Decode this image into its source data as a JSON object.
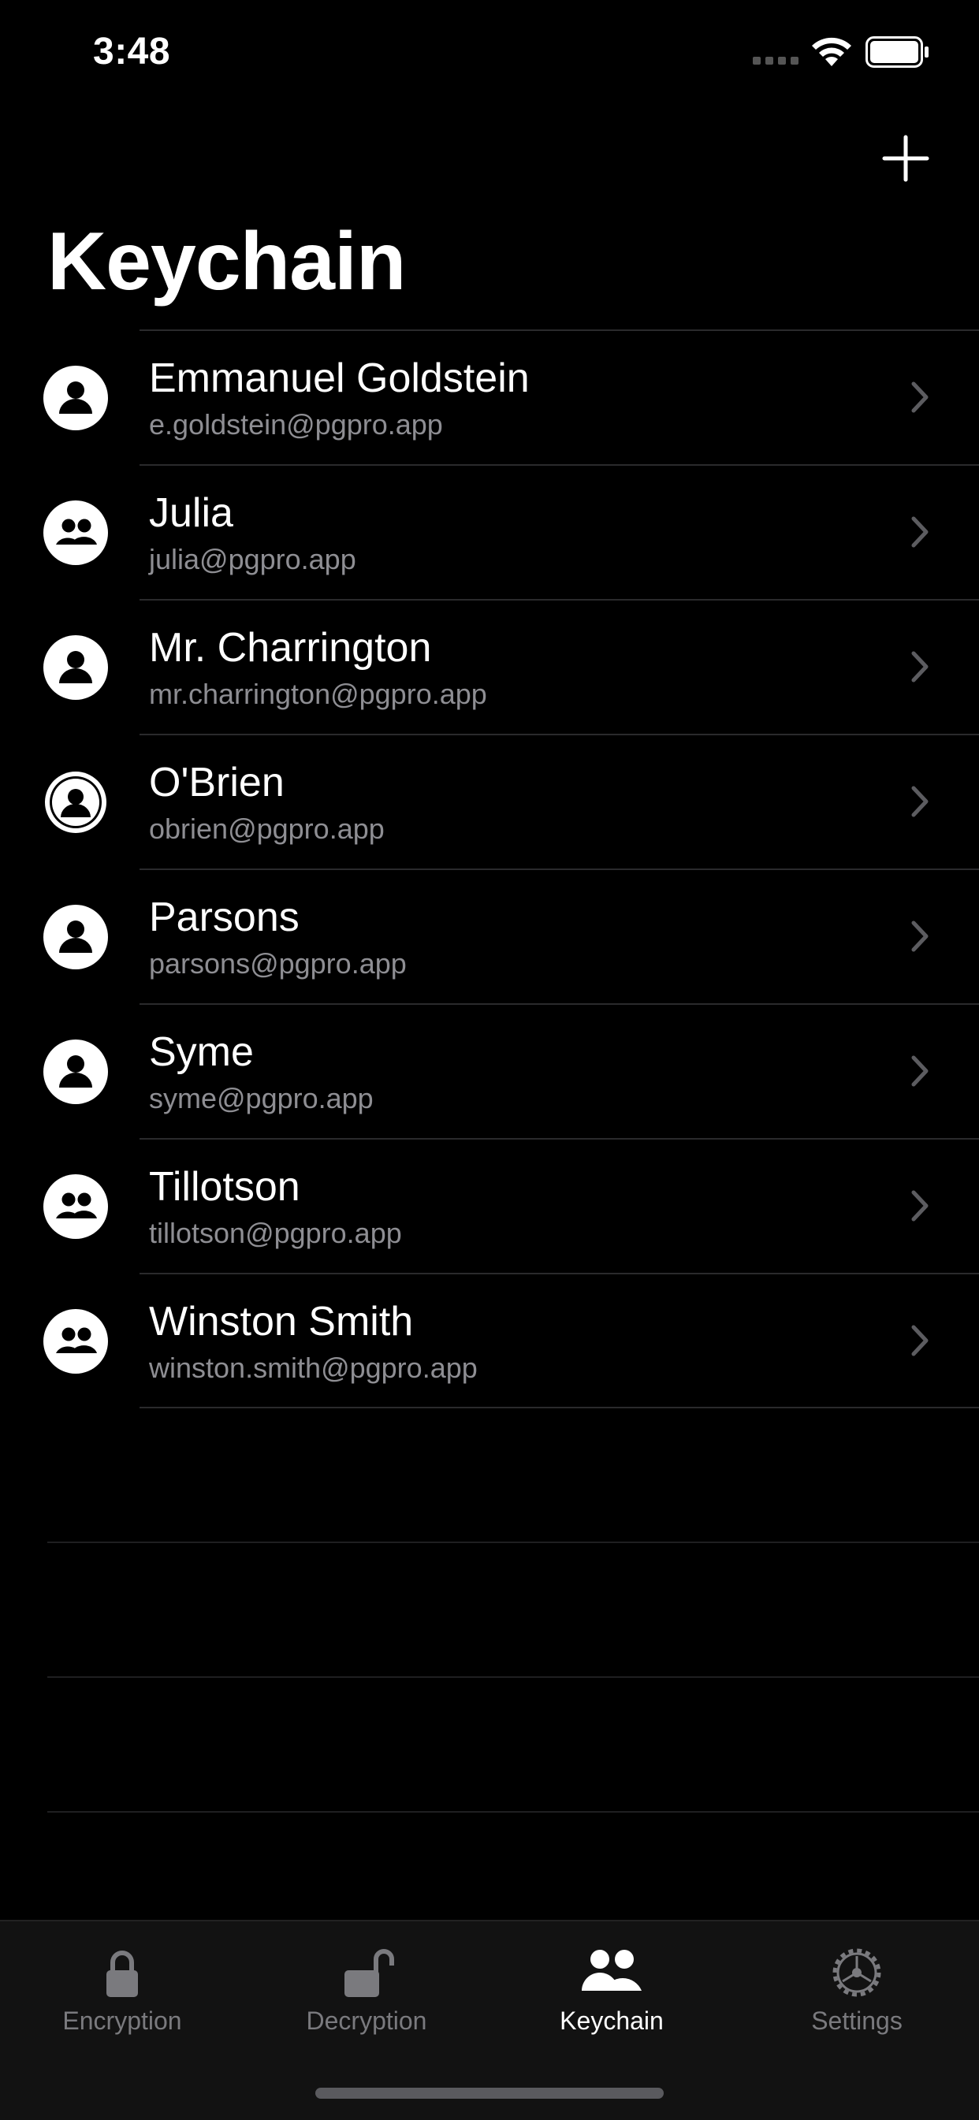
{
  "status_bar": {
    "time": "3:48"
  },
  "header": {
    "title": "Keychain"
  },
  "contacts": [
    {
      "name": "Emmanuel Goldstein",
      "email": "e.goldstein@pgpro.app",
      "icon": "person-icon"
    },
    {
      "name": "Julia",
      "email": "julia@pgpro.app",
      "icon": "two-people-icon"
    },
    {
      "name": "Mr. Charrington",
      "email": "mr.charrington@pgpro.app",
      "icon": "person-icon"
    },
    {
      "name": "O'Brien",
      "email": "obrien@pgpro.app",
      "icon": "person-outline-icon"
    },
    {
      "name": "Parsons",
      "email": "parsons@pgpro.app",
      "icon": "person-icon"
    },
    {
      "name": "Syme",
      "email": "syme@pgpro.app",
      "icon": "person-icon"
    },
    {
      "name": "Tillotson",
      "email": "tillotson@pgpro.app",
      "icon": "two-people-icon"
    },
    {
      "name": "Winston Smith",
      "email": "winston.smith@pgpro.app",
      "icon": "two-people-icon"
    }
  ],
  "tabs": [
    {
      "label": "Encryption",
      "icon": "lock-icon",
      "active": false
    },
    {
      "label": "Decryption",
      "icon": "unlock-icon",
      "active": false
    },
    {
      "label": "Keychain",
      "icon": "two-people-icon",
      "active": true
    },
    {
      "label": "Settings",
      "icon": "gear-icon",
      "active": false
    }
  ],
  "colors": {
    "background": "#000000",
    "secondary_text": "#8e8e93",
    "tab_bar": "#121212",
    "inactive_tab": "#7a7a7e"
  }
}
